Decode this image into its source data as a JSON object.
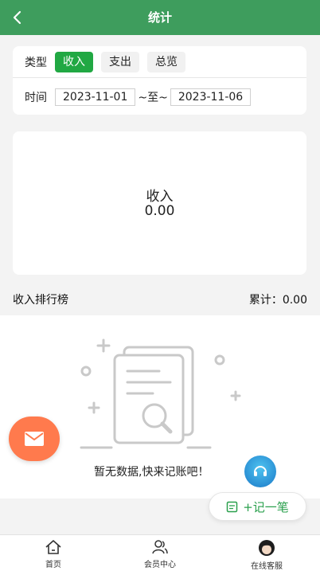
{
  "header": {
    "title": "统计",
    "back_icon": "chevron-left-icon"
  },
  "filter": {
    "type_label": "类型",
    "types": [
      {
        "label": "收入",
        "active": true
      },
      {
        "label": "支出",
        "active": false
      },
      {
        "label": "总览",
        "active": false
      }
    ],
    "time_label": "时间",
    "start_date": "2023-11-01",
    "separator": "~至~",
    "end_date": "2023-11-06"
  },
  "summary": {
    "label": "收入",
    "value": "0.00"
  },
  "ranking": {
    "title": "收入排行榜",
    "total_label": "累计：",
    "total_value": "0.00"
  },
  "empty": {
    "text": "暂无数据,快来记账吧！",
    "illustration_icon": "empty-document-search-icon"
  },
  "actions": {
    "add_label": "+记一笔",
    "add_icon": "note-icon",
    "mail_icon": "mail-icon",
    "support_icon": "customer-service-icon"
  },
  "nav": {
    "items": [
      {
        "label": "首页",
        "icon": "home-icon"
      },
      {
        "label": "会员中心",
        "icon": "user-icon"
      },
      {
        "label": "在线客服",
        "icon": "avatar-icon"
      }
    ]
  },
  "colors": {
    "header_bg": "#3e9d5d",
    "active_type": "#21a843",
    "fab": "#ff7a4d",
    "accent_text": "#2aa04d"
  }
}
